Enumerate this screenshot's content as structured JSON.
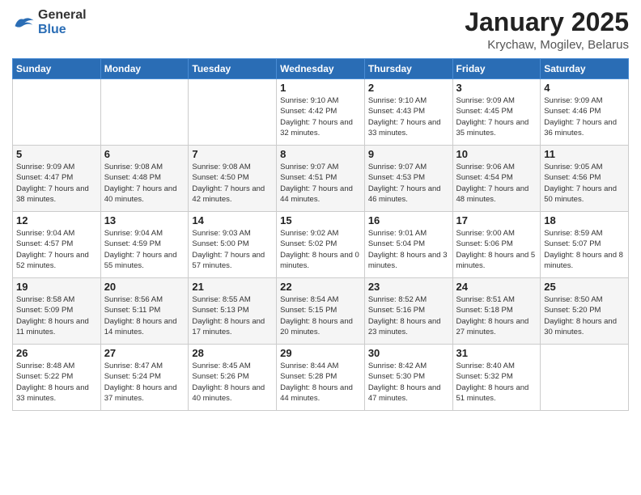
{
  "logo": {
    "general": "General",
    "blue": "Blue"
  },
  "title": "January 2025",
  "location": "Krychaw, Mogilev, Belarus",
  "weekdays": [
    "Sunday",
    "Monday",
    "Tuesday",
    "Wednesday",
    "Thursday",
    "Friday",
    "Saturday"
  ],
  "weeks": [
    [
      {
        "num": "",
        "sunrise": "",
        "sunset": "",
        "daylight": ""
      },
      {
        "num": "",
        "sunrise": "",
        "sunset": "",
        "daylight": ""
      },
      {
        "num": "",
        "sunrise": "",
        "sunset": "",
        "daylight": ""
      },
      {
        "num": "1",
        "sunrise": "Sunrise: 9:10 AM",
        "sunset": "Sunset: 4:42 PM",
        "daylight": "Daylight: 7 hours and 32 minutes."
      },
      {
        "num": "2",
        "sunrise": "Sunrise: 9:10 AM",
        "sunset": "Sunset: 4:43 PM",
        "daylight": "Daylight: 7 hours and 33 minutes."
      },
      {
        "num": "3",
        "sunrise": "Sunrise: 9:09 AM",
        "sunset": "Sunset: 4:45 PM",
        "daylight": "Daylight: 7 hours and 35 minutes."
      },
      {
        "num": "4",
        "sunrise": "Sunrise: 9:09 AM",
        "sunset": "Sunset: 4:46 PM",
        "daylight": "Daylight: 7 hours and 36 minutes."
      }
    ],
    [
      {
        "num": "5",
        "sunrise": "Sunrise: 9:09 AM",
        "sunset": "Sunset: 4:47 PM",
        "daylight": "Daylight: 7 hours and 38 minutes."
      },
      {
        "num": "6",
        "sunrise": "Sunrise: 9:08 AM",
        "sunset": "Sunset: 4:48 PM",
        "daylight": "Daylight: 7 hours and 40 minutes."
      },
      {
        "num": "7",
        "sunrise": "Sunrise: 9:08 AM",
        "sunset": "Sunset: 4:50 PM",
        "daylight": "Daylight: 7 hours and 42 minutes."
      },
      {
        "num": "8",
        "sunrise": "Sunrise: 9:07 AM",
        "sunset": "Sunset: 4:51 PM",
        "daylight": "Daylight: 7 hours and 44 minutes."
      },
      {
        "num": "9",
        "sunrise": "Sunrise: 9:07 AM",
        "sunset": "Sunset: 4:53 PM",
        "daylight": "Daylight: 7 hours and 46 minutes."
      },
      {
        "num": "10",
        "sunrise": "Sunrise: 9:06 AM",
        "sunset": "Sunset: 4:54 PM",
        "daylight": "Daylight: 7 hours and 48 minutes."
      },
      {
        "num": "11",
        "sunrise": "Sunrise: 9:05 AM",
        "sunset": "Sunset: 4:56 PM",
        "daylight": "Daylight: 7 hours and 50 minutes."
      }
    ],
    [
      {
        "num": "12",
        "sunrise": "Sunrise: 9:04 AM",
        "sunset": "Sunset: 4:57 PM",
        "daylight": "Daylight: 7 hours and 52 minutes."
      },
      {
        "num": "13",
        "sunrise": "Sunrise: 9:04 AM",
        "sunset": "Sunset: 4:59 PM",
        "daylight": "Daylight: 7 hours and 55 minutes."
      },
      {
        "num": "14",
        "sunrise": "Sunrise: 9:03 AM",
        "sunset": "Sunset: 5:00 PM",
        "daylight": "Daylight: 7 hours and 57 minutes."
      },
      {
        "num": "15",
        "sunrise": "Sunrise: 9:02 AM",
        "sunset": "Sunset: 5:02 PM",
        "daylight": "Daylight: 8 hours and 0 minutes."
      },
      {
        "num": "16",
        "sunrise": "Sunrise: 9:01 AM",
        "sunset": "Sunset: 5:04 PM",
        "daylight": "Daylight: 8 hours and 3 minutes."
      },
      {
        "num": "17",
        "sunrise": "Sunrise: 9:00 AM",
        "sunset": "Sunset: 5:06 PM",
        "daylight": "Daylight: 8 hours and 5 minutes."
      },
      {
        "num": "18",
        "sunrise": "Sunrise: 8:59 AM",
        "sunset": "Sunset: 5:07 PM",
        "daylight": "Daylight: 8 hours and 8 minutes."
      }
    ],
    [
      {
        "num": "19",
        "sunrise": "Sunrise: 8:58 AM",
        "sunset": "Sunset: 5:09 PM",
        "daylight": "Daylight: 8 hours and 11 minutes."
      },
      {
        "num": "20",
        "sunrise": "Sunrise: 8:56 AM",
        "sunset": "Sunset: 5:11 PM",
        "daylight": "Daylight: 8 hours and 14 minutes."
      },
      {
        "num": "21",
        "sunrise": "Sunrise: 8:55 AM",
        "sunset": "Sunset: 5:13 PM",
        "daylight": "Daylight: 8 hours and 17 minutes."
      },
      {
        "num": "22",
        "sunrise": "Sunrise: 8:54 AM",
        "sunset": "Sunset: 5:15 PM",
        "daylight": "Daylight: 8 hours and 20 minutes."
      },
      {
        "num": "23",
        "sunrise": "Sunrise: 8:52 AM",
        "sunset": "Sunset: 5:16 PM",
        "daylight": "Daylight: 8 hours and 23 minutes."
      },
      {
        "num": "24",
        "sunrise": "Sunrise: 8:51 AM",
        "sunset": "Sunset: 5:18 PM",
        "daylight": "Daylight: 8 hours and 27 minutes."
      },
      {
        "num": "25",
        "sunrise": "Sunrise: 8:50 AM",
        "sunset": "Sunset: 5:20 PM",
        "daylight": "Daylight: 8 hours and 30 minutes."
      }
    ],
    [
      {
        "num": "26",
        "sunrise": "Sunrise: 8:48 AM",
        "sunset": "Sunset: 5:22 PM",
        "daylight": "Daylight: 8 hours and 33 minutes."
      },
      {
        "num": "27",
        "sunrise": "Sunrise: 8:47 AM",
        "sunset": "Sunset: 5:24 PM",
        "daylight": "Daylight: 8 hours and 37 minutes."
      },
      {
        "num": "28",
        "sunrise": "Sunrise: 8:45 AM",
        "sunset": "Sunset: 5:26 PM",
        "daylight": "Daylight: 8 hours and 40 minutes."
      },
      {
        "num": "29",
        "sunrise": "Sunrise: 8:44 AM",
        "sunset": "Sunset: 5:28 PM",
        "daylight": "Daylight: 8 hours and 44 minutes."
      },
      {
        "num": "30",
        "sunrise": "Sunrise: 8:42 AM",
        "sunset": "Sunset: 5:30 PM",
        "daylight": "Daylight: 8 hours and 47 minutes."
      },
      {
        "num": "31",
        "sunrise": "Sunrise: 8:40 AM",
        "sunset": "Sunset: 5:32 PM",
        "daylight": "Daylight: 8 hours and 51 minutes."
      },
      {
        "num": "",
        "sunrise": "",
        "sunset": "",
        "daylight": ""
      }
    ]
  ]
}
